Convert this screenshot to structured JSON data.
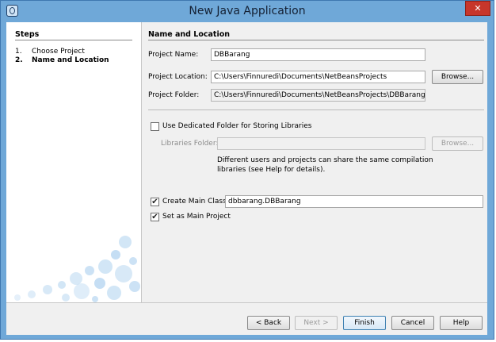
{
  "window": {
    "title": "New Java Application",
    "close_label": "✕"
  },
  "steps": {
    "title": "Steps",
    "items": [
      {
        "num": "1.",
        "label": "Choose Project"
      },
      {
        "num": "2.",
        "label": "Name and Location"
      }
    ]
  },
  "main": {
    "section_title": "Name and Location",
    "project_name_label": "Project Name:",
    "project_name_value": "DBBarang",
    "project_location_label": "Project Location:",
    "project_location_value": "C:\\Users\\Finnuredi\\Documents\\NetBeansProjects",
    "browse_label": "Browse...",
    "project_folder_label": "Project Folder:",
    "project_folder_value": "C:\\Users\\Finnuredi\\Documents\\NetBeansProjects\\DBBarang",
    "dedicated_folder_label": "Use Dedicated Folder for Storing Libraries",
    "dedicated_folder_checked": false,
    "libraries_folder_label": "Libraries Folder:",
    "libraries_folder_value": "",
    "libraries_browse_label": "Browse...",
    "libraries_desc_line1": "Different users and projects can share the same compilation",
    "libraries_desc_line2": "libraries (see Help for details).",
    "create_main_class_label": "Create Main Class",
    "create_main_class_checked": true,
    "main_class_value": "dbbarang.DBBarang",
    "set_main_project_label": "Set as Main Project",
    "set_main_project_checked": true
  },
  "buttons": {
    "back": "< Back",
    "next": "Next >",
    "finish": "Finish",
    "cancel": "Cancel",
    "help": "Help"
  },
  "icons": {
    "check": "✔"
  },
  "colors": {
    "titlebar": "#6fa8d8",
    "close": "#c7362b"
  }
}
